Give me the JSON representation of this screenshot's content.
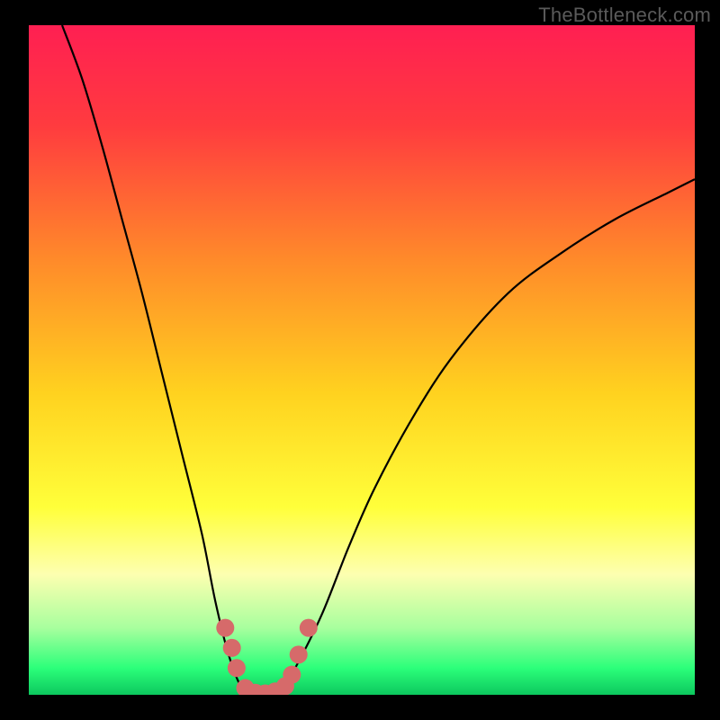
{
  "watermark": "TheBottleneck.com",
  "chart_data": {
    "type": "line",
    "title": "",
    "xlabel": "",
    "ylabel": "",
    "xlim": [
      0,
      100
    ],
    "ylim": [
      0,
      100
    ],
    "background_gradient": {
      "stops": [
        {
          "offset": 0.0,
          "color": "#ff1f52"
        },
        {
          "offset": 0.15,
          "color": "#ff3b3f"
        },
        {
          "offset": 0.35,
          "color": "#ff8a2a"
        },
        {
          "offset": 0.55,
          "color": "#ffd21f"
        },
        {
          "offset": 0.72,
          "color": "#ffff3a"
        },
        {
          "offset": 0.82,
          "color": "#fdffb0"
        },
        {
          "offset": 0.9,
          "color": "#a8ff9e"
        },
        {
          "offset": 0.96,
          "color": "#2cff7a"
        },
        {
          "offset": 1.0,
          "color": "#0cc85e"
        }
      ]
    },
    "series": [
      {
        "name": "curve",
        "color": "#000000",
        "points": [
          {
            "x": 5,
            "y": 100
          },
          {
            "x": 8,
            "y": 92
          },
          {
            "x": 11,
            "y": 82
          },
          {
            "x": 14,
            "y": 71
          },
          {
            "x": 17,
            "y": 60
          },
          {
            "x": 20,
            "y": 48
          },
          {
            "x": 23,
            "y": 36
          },
          {
            "x": 26,
            "y": 24
          },
          {
            "x": 28,
            "y": 14
          },
          {
            "x": 30,
            "y": 6
          },
          {
            "x": 32,
            "y": 1
          },
          {
            "x": 34,
            "y": 0
          },
          {
            "x": 36,
            "y": 0
          },
          {
            "x": 38,
            "y": 1
          },
          {
            "x": 40,
            "y": 4
          },
          {
            "x": 44,
            "y": 12
          },
          {
            "x": 48,
            "y": 22
          },
          {
            "x": 52,
            "y": 31
          },
          {
            "x": 58,
            "y": 42
          },
          {
            "x": 64,
            "y": 51
          },
          {
            "x": 72,
            "y": 60
          },
          {
            "x": 80,
            "y": 66
          },
          {
            "x": 88,
            "y": 71
          },
          {
            "x": 96,
            "y": 75
          },
          {
            "x": 100,
            "y": 77
          }
        ]
      }
    ],
    "markers": {
      "color": "#d66a6a",
      "points": [
        {
          "x": 29.5,
          "y": 10
        },
        {
          "x": 30.5,
          "y": 7
        },
        {
          "x": 31.2,
          "y": 4
        },
        {
          "x": 32.5,
          "y": 1
        },
        {
          "x": 34.0,
          "y": 0.3
        },
        {
          "x": 35.5,
          "y": 0.2
        },
        {
          "x": 37.0,
          "y": 0.5
        },
        {
          "x": 38.5,
          "y": 1.3
        },
        {
          "x": 39.5,
          "y": 3
        },
        {
          "x": 40.5,
          "y": 6
        },
        {
          "x": 42.0,
          "y": 10
        }
      ]
    }
  }
}
